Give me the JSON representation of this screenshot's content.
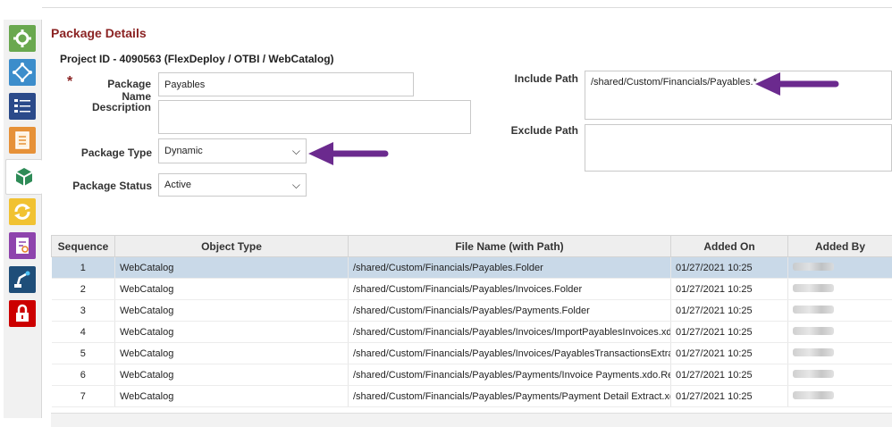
{
  "sidebar": {
    "items": [
      {
        "icon": "gear-icon",
        "color": "#6aa84f"
      },
      {
        "icon": "network-icon",
        "color": "#3c8dcb"
      },
      {
        "icon": "checklist-icon",
        "color": "#2b4a8a"
      },
      {
        "icon": "document-icon",
        "color": "#e69138"
      },
      {
        "icon": "package-icon",
        "color": "#2e8b57"
      },
      {
        "icon": "refresh-icon",
        "color": "#f1c232"
      },
      {
        "icon": "report-icon",
        "color": "#8e44ad"
      },
      {
        "icon": "robot-arm-icon",
        "color": "#1f4e79"
      },
      {
        "icon": "lock-icon",
        "color": "#cc0000"
      }
    ]
  },
  "header": {
    "title": "Package Details",
    "project": "Project ID - 4090563 (FlexDeploy / OTBI / WebCatalog)"
  },
  "form": {
    "required_marker": "*",
    "package_name_label": "Package Name",
    "package_name_value": "Payables",
    "description_label": "Description",
    "description_value": "",
    "package_type_label": "Package Type",
    "package_type_value": "Dynamic",
    "package_status_label": "Package Status",
    "package_status_value": "Active",
    "include_path_label": "Include Path",
    "include_path_value": "/shared/Custom/Financials/Payables.*",
    "exclude_path_label": "Exclude Path",
    "exclude_path_value": ""
  },
  "table": {
    "headers": [
      "Sequence",
      "Object Type",
      "File Name (with Path)",
      "Added On",
      "Added By"
    ],
    "rows": [
      {
        "seq": "1",
        "type": "WebCatalog",
        "file": "/shared/Custom/Financials/Payables.Folder",
        "added_on": "01/27/2021 10:25"
      },
      {
        "seq": "2",
        "type": "WebCatalog",
        "file": "/shared/Custom/Financials/Payables/Invoices.Folder",
        "added_on": "01/27/2021 10:25"
      },
      {
        "seq": "3",
        "type": "WebCatalog",
        "file": "/shared/Custom/Financials/Payables/Payments.Folder",
        "added_on": "01/27/2021 10:25"
      },
      {
        "seq": "4",
        "type": "WebCatalog",
        "file": "/shared/Custom/Financials/Payables/Invoices/ImportPayablesInvoices.xdo",
        "added_on": "01/27/2021 10:25"
      },
      {
        "seq": "5",
        "type": "WebCatalog",
        "file": "/shared/Custom/Financials/Payables/Invoices/PayablesTransactionsExtract",
        "added_on": "01/27/2021 10:25"
      },
      {
        "seq": "6",
        "type": "WebCatalog",
        "file": "/shared/Custom/Financials/Payables/Payments/Invoice Payments.xdo.Rep",
        "added_on": "01/27/2021 10:25"
      },
      {
        "seq": "7",
        "type": "WebCatalog",
        "file": "/shared/Custom/Financials/Payables/Payments/Payment Detail Extract.xdo",
        "added_on": "01/27/2021 10:25"
      }
    ]
  },
  "colors": {
    "title": "#8b2323",
    "arrow": "#6b2a8e",
    "selected_row": "#c9d9e8"
  }
}
